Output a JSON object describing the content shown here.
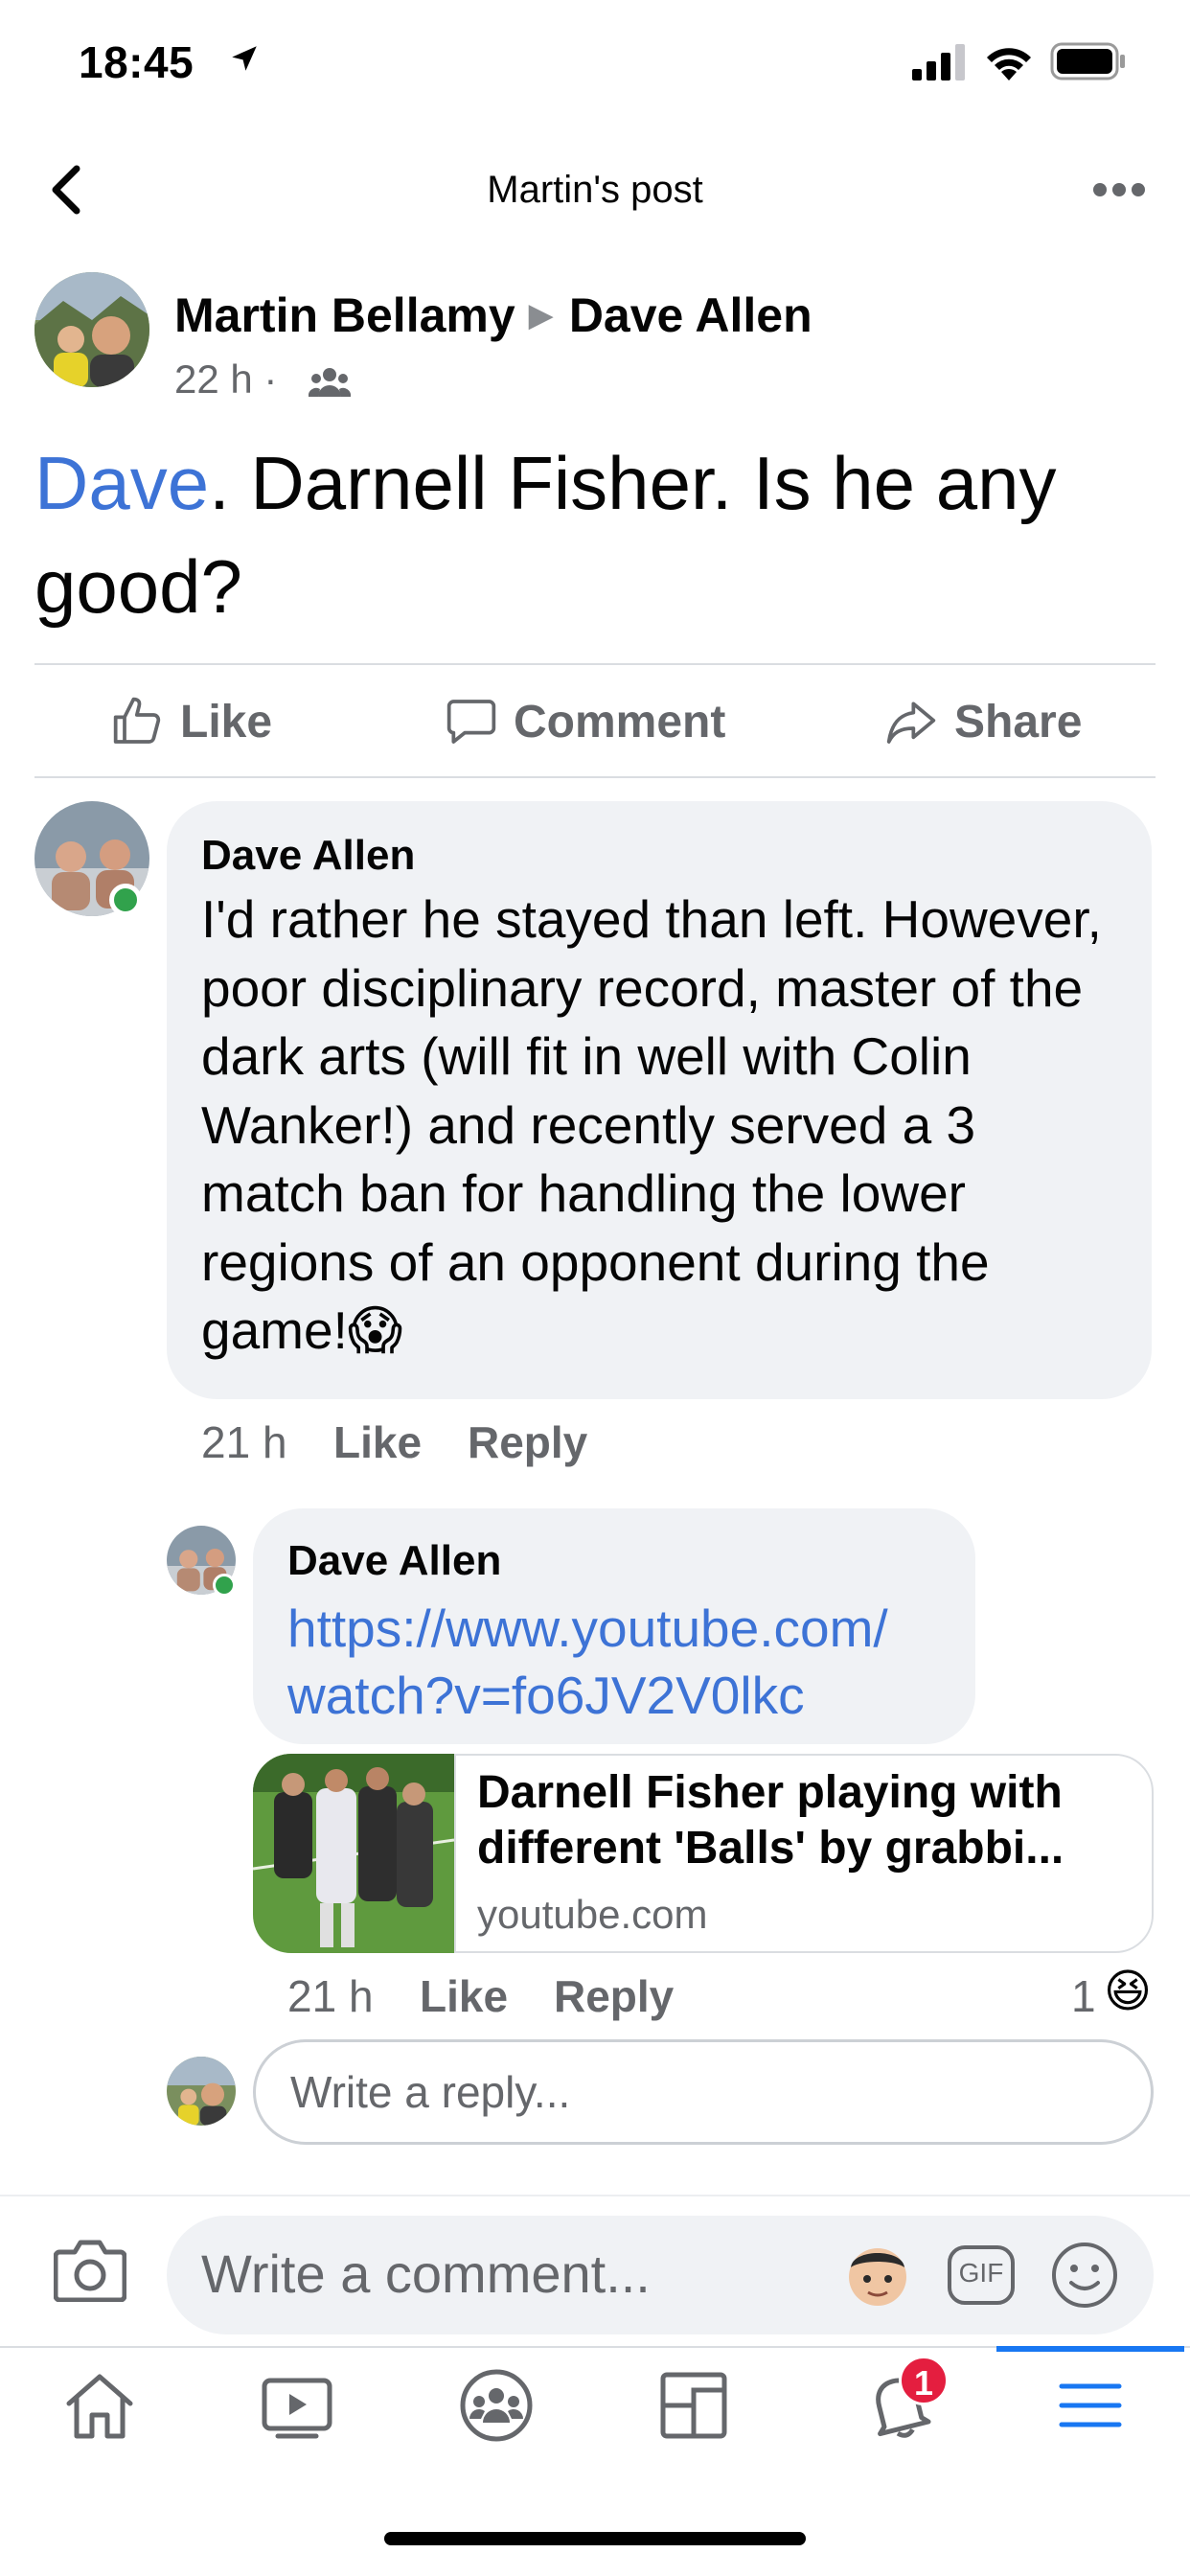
{
  "status_bar": {
    "time": "18:45"
  },
  "nav": {
    "title": "Martin's post"
  },
  "post": {
    "author": "Martin Bellamy",
    "target": "Dave Allen",
    "time": "22 h",
    "separator": "·",
    "text_tag": "Dave",
    "text_rest": ". Darnell Fisher. Is he any good?"
  },
  "actions": {
    "like": "Like",
    "comment": "Comment",
    "share": "Share"
  },
  "comments": [
    {
      "author": "Dave Allen",
      "text": "I'd rather he stayed than left. However, poor disciplinary record, master of the dark arts (will fit in well with Colin Wanker!) and recently served a 3 match ban for handling the lower regions of an opponent during the game!",
      "emoji": "😱",
      "time": "21 h",
      "like": "Like",
      "reply": "Reply"
    }
  ],
  "reply": {
    "author": "Dave Allen",
    "link_line1": "https://www.youtube.com/",
    "link_line2": "watch?v=fo6JV2V0lkc",
    "preview_title": "Darnell Fisher playing with different 'Balls' by grabbi...",
    "preview_domain": "youtube.com",
    "time": "21 h",
    "like": "Like",
    "reply": "Reply",
    "reaction_count": "1",
    "reaction_emoji": "😆"
  },
  "reply_input": {
    "placeholder": "Write a reply..."
  },
  "composer": {
    "placeholder": "Write a comment...",
    "gif_label": "GIF"
  },
  "tabbar": {
    "notifications_badge": "1"
  },
  "colors": {
    "link": "#3d73d6",
    "active_tab": "#1877f2",
    "online": "#31a24c",
    "badge": "#e41e3f"
  }
}
